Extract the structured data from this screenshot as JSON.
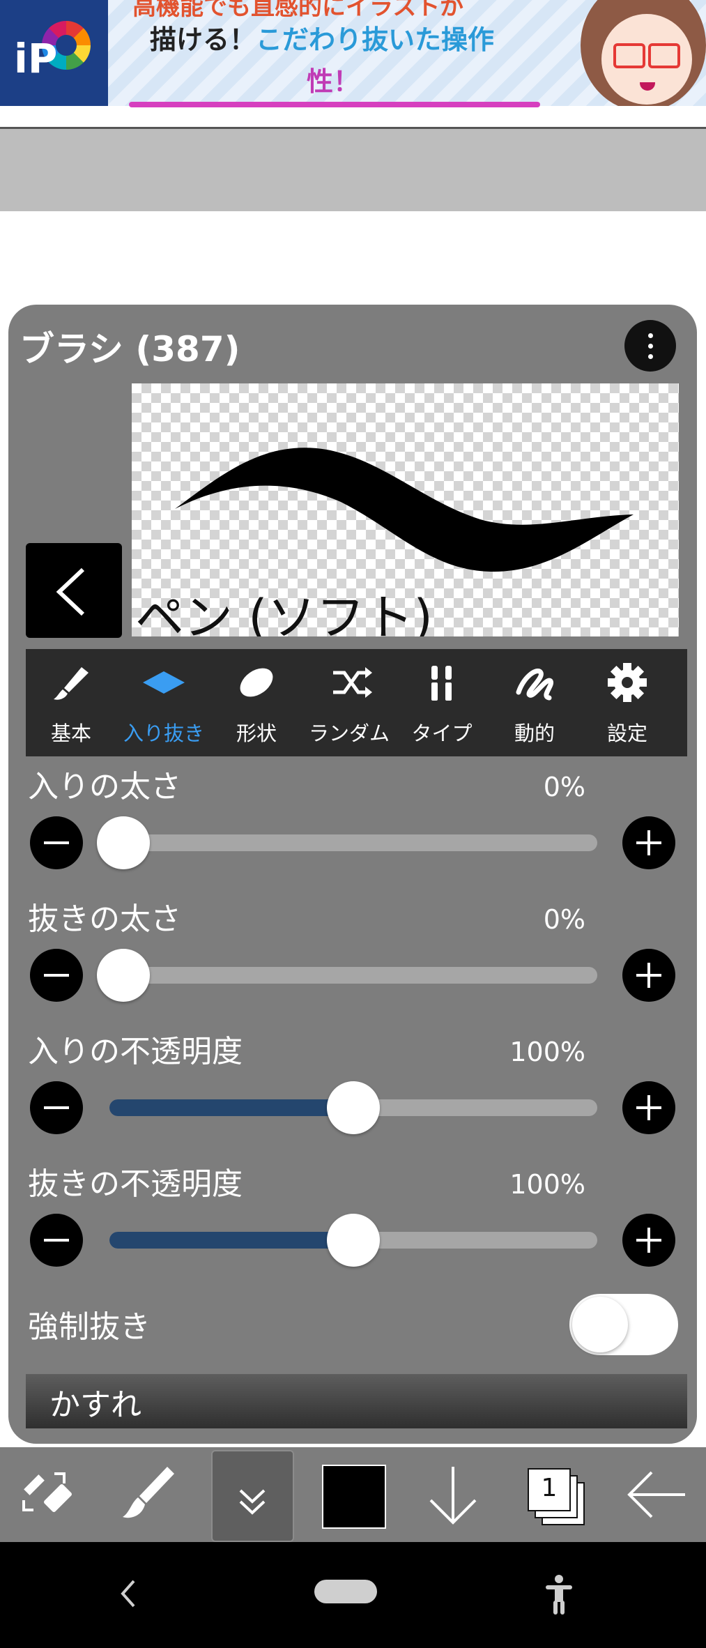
{
  "ad": {
    "line1": "高機能でも直感的にイラストが",
    "line2a": "描ける！",
    "line2b": "こだわり抜いた操作",
    "line3": "性！",
    "logo_text": "iP"
  },
  "panel": {
    "title": "ブラシ (387)",
    "brush_name": "ペン (ソフト)",
    "tabs": [
      {
        "label": "基本",
        "icon": "brush-icon",
        "active": false
      },
      {
        "label": "入り抜き",
        "icon": "diamond-icon",
        "active": true
      },
      {
        "label": "形状",
        "icon": "ellipse-icon",
        "active": false
      },
      {
        "label": "ランダム",
        "icon": "shuffle-icon",
        "active": false
      },
      {
        "label": "タイプ",
        "icon": "type-icon",
        "active": false
      },
      {
        "label": "動的",
        "icon": "dynamic-icon",
        "active": false
      },
      {
        "label": "設定",
        "icon": "gear-icon",
        "active": false
      }
    ],
    "sliders": [
      {
        "label": "入りの太さ",
        "value": "0%",
        "level": 0.0
      },
      {
        "label": "抜きの太さ",
        "value": "0%",
        "level": 0.0
      },
      {
        "label": "入りの不透明度",
        "value": "100%",
        "level": 0.5
      },
      {
        "label": "抜きの不透明度",
        "value": "100%",
        "level": 0.5
      }
    ],
    "force_taper": {
      "label": "強制抜き",
      "on": false
    },
    "section": "かすれ"
  },
  "toolbar": {
    "layer_count": "1",
    "color": "#000000",
    "items": [
      "transform-icon",
      "brush-icon",
      "double-chevron-down-icon",
      "color-swatch",
      "arrow-down-icon",
      "layers-icon",
      "arrow-left-icon"
    ]
  },
  "colors": {
    "panel_bg": "#7d7d7d",
    "accent": "#3a9df2",
    "slider_fill": "#24466e",
    "track": "#a6a6a6"
  }
}
